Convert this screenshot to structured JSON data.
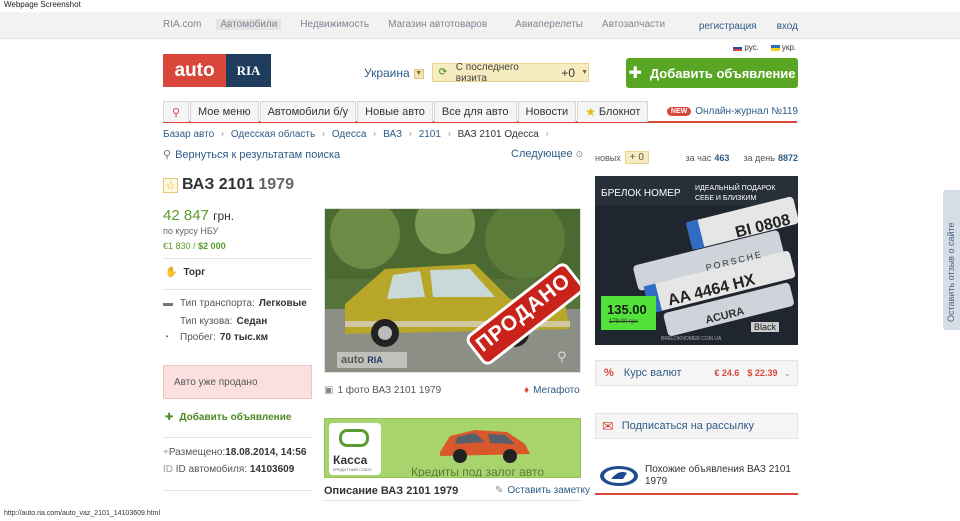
{
  "screenshot_title": "Webpage Screenshot",
  "topnav": [
    "RIA.com",
    "Автомобили",
    "Недвижимость",
    "Магазин автотоваров",
    "Авиаперелеты",
    "Автозапчасти"
  ],
  "toplinks": {
    "register": "регистрация",
    "login": "вход"
  },
  "langs": {
    "ru": "рус.",
    "ua": "укр."
  },
  "logo": {
    "auto": "auto",
    "ria": "RIA"
  },
  "region": "Украина",
  "since_visit": {
    "label": "С последнего визита",
    "count": "+0"
  },
  "add_button": "Добавить объявление",
  "tabs": [
    "Мое меню",
    "Автомобили б/у",
    "Новые авто",
    "Все для авто",
    "Новости",
    "Блокнот"
  ],
  "journal": {
    "badge": "NEW",
    "label": "Онлайн-журнал №119"
  },
  "breadcrumbs": [
    "Базар авто",
    "Одесская область",
    "Одесса",
    "ВАЗ",
    "2101",
    "ВАЗ 2101 Одесса"
  ],
  "back_to_results": "Вернуться к результатам поиска",
  "next_link": "Следующее",
  "stats": {
    "new_label": "новых",
    "new_count": "+ 0",
    "hour_label": "за час",
    "hour_count": "463",
    "day_label": "за день",
    "day_count": "8872"
  },
  "listing": {
    "make_model": "ВАЗ 2101",
    "year": "1979",
    "price": "42 847",
    "price_currency": "грн.",
    "nbu_note": "по курсу НБУ",
    "alt_price_eur": "€1 830",
    "alt_price_usd": "$2 000",
    "bargain": "Торг",
    "specs": [
      {
        "label": "Тип транспорта:",
        "value": "Легковые"
      },
      {
        "label": "Тип кузова:",
        "value": "Седан"
      },
      {
        "label": "Пробег:",
        "value": "70 тыс.км"
      }
    ],
    "sold_notice": "Авто уже продано",
    "add_ad_link": "Добавить объявление",
    "placed_label": "Размещено:",
    "placed_value": "18.08.2014, 14:56",
    "id_label": "ID автомобиля:",
    "id_value": "14103609"
  },
  "photo": {
    "sold_stamp": "ПРОДАНО",
    "watermark_auto": "auto",
    "watermark_ria": "RIA",
    "caption": "1 фото ВАЗ 2101 1979",
    "mega": "Мегафото"
  },
  "kassa_ad": {
    "brand": "Касса",
    "sub": "КРЕДИТНЫЙ СОЮЗ",
    "text": "Кредиты под залог авто"
  },
  "description_title": "Описание ВАЗ 2101 1979",
  "note_link": "Оставить заметку",
  "banner": {
    "title": "БРЕЛОК НОМЕР",
    "slogan": "ИДЕАЛЬНЫЙ ПОДАРОК СЕБЕ И БЛИЗКИМ",
    "plate1": "BI 0808",
    "plate2": "PORSCHE",
    "plate3": "AA 4464 HX",
    "plate4": "ACURA",
    "price": "135.00",
    "old_price": "179.00 грн",
    "color_label": "Black",
    "site": "BRELOKNOMER.COM.UA"
  },
  "currency": {
    "label": "Курс валют",
    "eur": "€ 24.6",
    "usd": "$ 22.39"
  },
  "subscribe": "Подписаться на рассылку",
  "similar": "Похожие объявления ВАЗ 2101 1979",
  "feedback": "Оставить отзыв о сайте",
  "status_url": "http://auto.ria.com/auto_vaz_2101_14103609.html",
  "colors": {
    "accent_red": "#d9463a",
    "green": "#58a623",
    "link": "#2f5b87",
    "navy": "#1f3b5e"
  }
}
